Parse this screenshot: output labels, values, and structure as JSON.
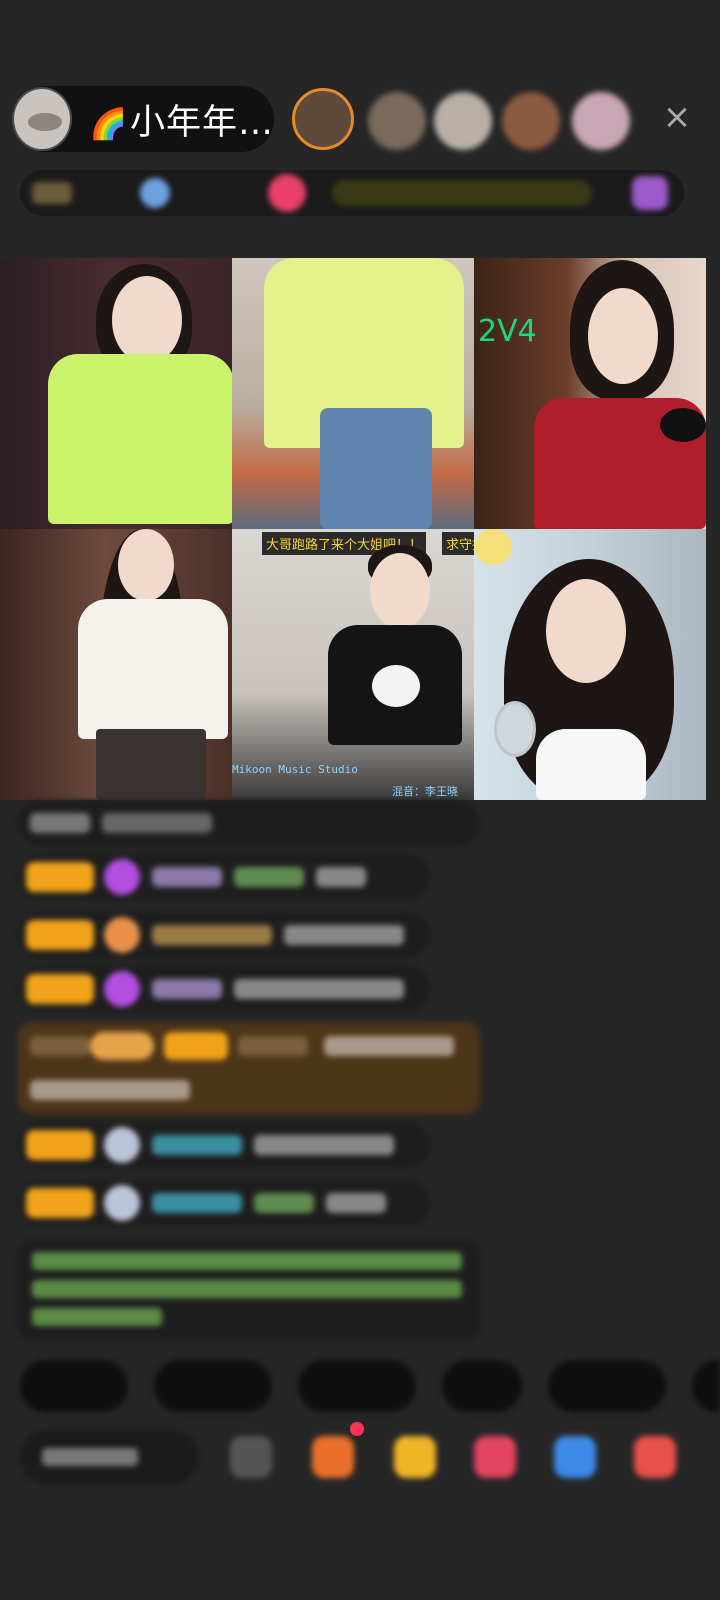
{
  "header": {
    "host_emoji": "🌈",
    "host_name": "小年年…",
    "close_icon": "×"
  },
  "grid": {
    "pk_label": "2V4",
    "banner_text": "大哥跑路了来个大姐吧！！",
    "banner_text_2": "求守护",
    "studio_text": "Mikoon Music Studio",
    "credit_text": "混音：李王晓"
  },
  "colors": {
    "background": "#262626",
    "badge": "#f0a21a",
    "pk_green": "#1fd67d",
    "banner_yellow": "#f5d43a"
  }
}
